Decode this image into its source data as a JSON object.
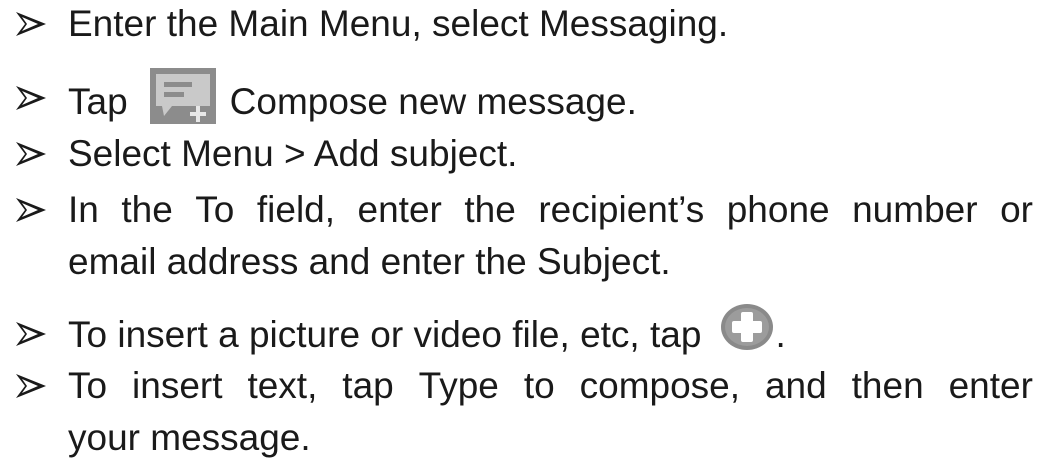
{
  "bullet_icon": "arrowhead-bullet-icon",
  "icons": {
    "compose": "compose-message-icon",
    "add": "add-attachment-icon"
  },
  "steps": [
    {
      "text": "Enter the Main Menu, select Messaging."
    },
    {
      "before": "Tap",
      "after": "Compose new message."
    },
    {
      "text": "Select Menu > Add subject."
    },
    {
      "line1_words": [
        "In",
        "the",
        "To",
        "field,",
        "enter",
        "the",
        "recipient’s",
        "phone",
        "number",
        "or"
      ],
      "line2": "email address and enter the Subject."
    },
    {
      "before": "To insert a picture or video file, etc, tap",
      "after": "."
    },
    {
      "line1_words": [
        "To",
        "insert",
        "text,",
        "tap",
        "Type",
        "to",
        "compose,",
        "and",
        "then",
        "enter"
      ],
      "line2": "your message."
    }
  ]
}
